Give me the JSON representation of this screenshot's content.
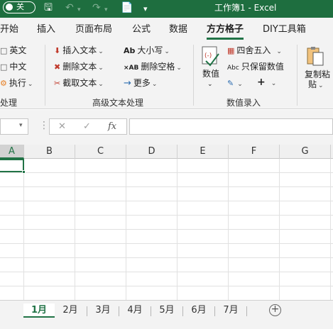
{
  "titlebar": {
    "autosave_label": "关",
    "title": "工作簿1  -  Excel"
  },
  "ribbon_tabs": [
    "开始",
    "插入",
    "页面布局",
    "公式",
    "数据",
    "方方格子",
    "DIY工具箱"
  ],
  "ribbon": {
    "left_group": {
      "items": [
        "英文",
        "中文",
        "执行"
      ],
      "label": "处理"
    },
    "text_group": {
      "items": [
        "插入文本",
        "删除文本",
        "截取文本",
        "大小写",
        "删除空格",
        "更多"
      ],
      "label": "高级文本处理"
    },
    "number_group": {
      "big_button": "数值",
      "items": [
        "四舍五入",
        "只保留数值",
        "+"
      ],
      "label": "数值录入"
    },
    "paste_group": {
      "line1": "复制粘",
      "line2": "贴"
    }
  },
  "formula_bar": {
    "cancel": "✕",
    "confirm": "✓",
    "fx": "fx"
  },
  "columns": [
    "A",
    "B",
    "C",
    "D",
    "E",
    "F",
    "G"
  ],
  "sheets": [
    "1月",
    "2月",
    "3月",
    "4月",
    "5月",
    "6月",
    "7月"
  ],
  "active_sheet": "1月",
  "colors": {
    "title_bar": "#1e6e3f",
    "accent": "#217346"
  }
}
